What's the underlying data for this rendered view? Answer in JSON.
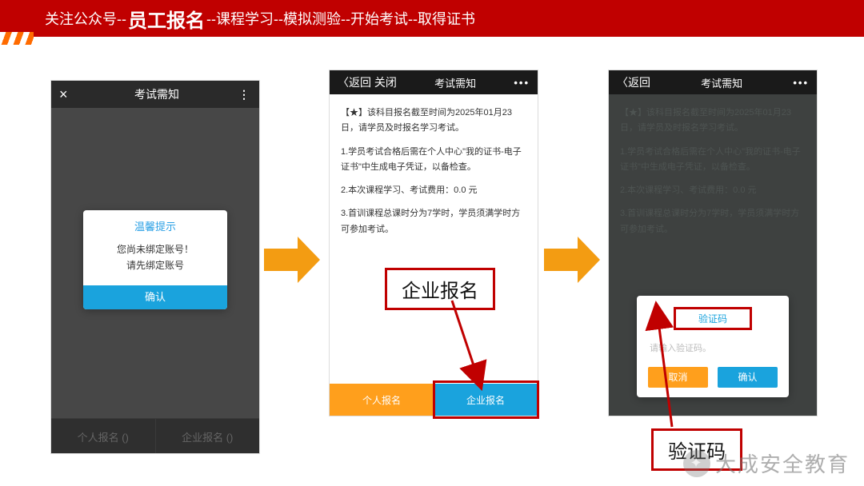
{
  "topbar": {
    "t1": "关注公众号--",
    "accent": "员工报名",
    "t2": "--课程学习--模拟测验--开始考试--取得证书"
  },
  "phone1": {
    "title": "考试需知",
    "close": "×",
    "more": "⋮",
    "dialog": {
      "title": "温馨提示",
      "line1": "您尚未绑定账号！",
      "line2": "请先绑定账号",
      "confirm": "确认"
    },
    "bottom_left": "个人报名 ()",
    "bottom_right": "企业报名 ()"
  },
  "phone2": {
    "back": "返回",
    "close": "关闭",
    "title": "考试需知",
    "more": "•••",
    "notice": {
      "p1": "【★】该科目报名截至时间为2025年01月23日，请学员及时报名学习考试。",
      "p2": "1.学员考试合格后需在个人中心\"我的证书-电子证书\"中生成电子凭证，以备检查。",
      "p3": "2.本次课程学习、考试费用：0.0 元",
      "p4": "3.首训课程总课时分为7学时，学员须满学时方可参加考试。"
    },
    "btn_left": "个人报名",
    "btn_right": "企业报名"
  },
  "callout_enterprise": "企业报名",
  "phone3": {
    "back": "返回",
    "title": "考试需知",
    "more": "•••",
    "notice": {
      "p1": "【★】该科目报名截至时间为2025年01月23日，请学员及时报名学习考试。",
      "p2": "1.学员考试合格后需在个人中心\"我的证书-电子证书\"中生成电子凭证，以备检查。",
      "p3": "2.本次课程学习、考试费用：0.0 元",
      "p4": "3.首训课程总课时分为7学时，学员须满学时方可参加考试。"
    },
    "dialog": {
      "title": "验证码",
      "placeholder": "请输入验证码。",
      "cancel": "取消",
      "ok": "确认"
    }
  },
  "callout_code": "验证码",
  "watermark": "大成安全教育"
}
